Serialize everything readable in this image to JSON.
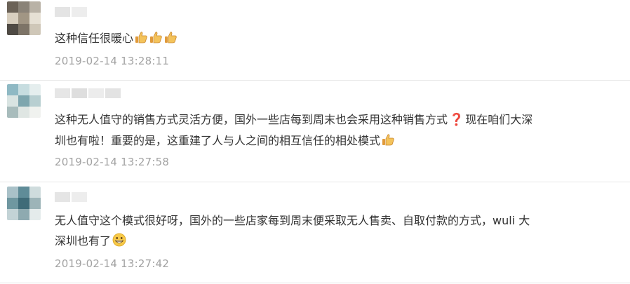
{
  "comments": [
    {
      "text": "这种信任很暖心",
      "emoji": [
        "thumbs-up",
        "thumbs-up",
        "thumbs-up"
      ],
      "time": "2019-02-14 13:28:11"
    },
    {
      "text_line1": "这种无人值守的销售方式灵活方便，国外一些店每到周末也会采用这种销售方式",
      "mark": "❓",
      "text_line1_tail": "现在咱们大深",
      "text_line2": "圳也有啦！重要的是，这重建了人与人之间的相互信任的相处模式",
      "emoji": [
        "thumbs-up"
      ],
      "time": "2019-02-14 13:27:58"
    },
    {
      "text_line1": "无人值守这个模式很好呀，国外的一些店家每到周末便采取无人售卖、自取付款的方式，wuli 大",
      "text_line2": "深圳也有了",
      "emoji": [
        "grinning-face"
      ],
      "time": "2019-02-14 13:27:42"
    }
  ],
  "colors": {
    "text": "#333333",
    "timestamp": "#a3a3a3",
    "divider": "#e8e8e8",
    "question_mark": "#d11a2a"
  }
}
